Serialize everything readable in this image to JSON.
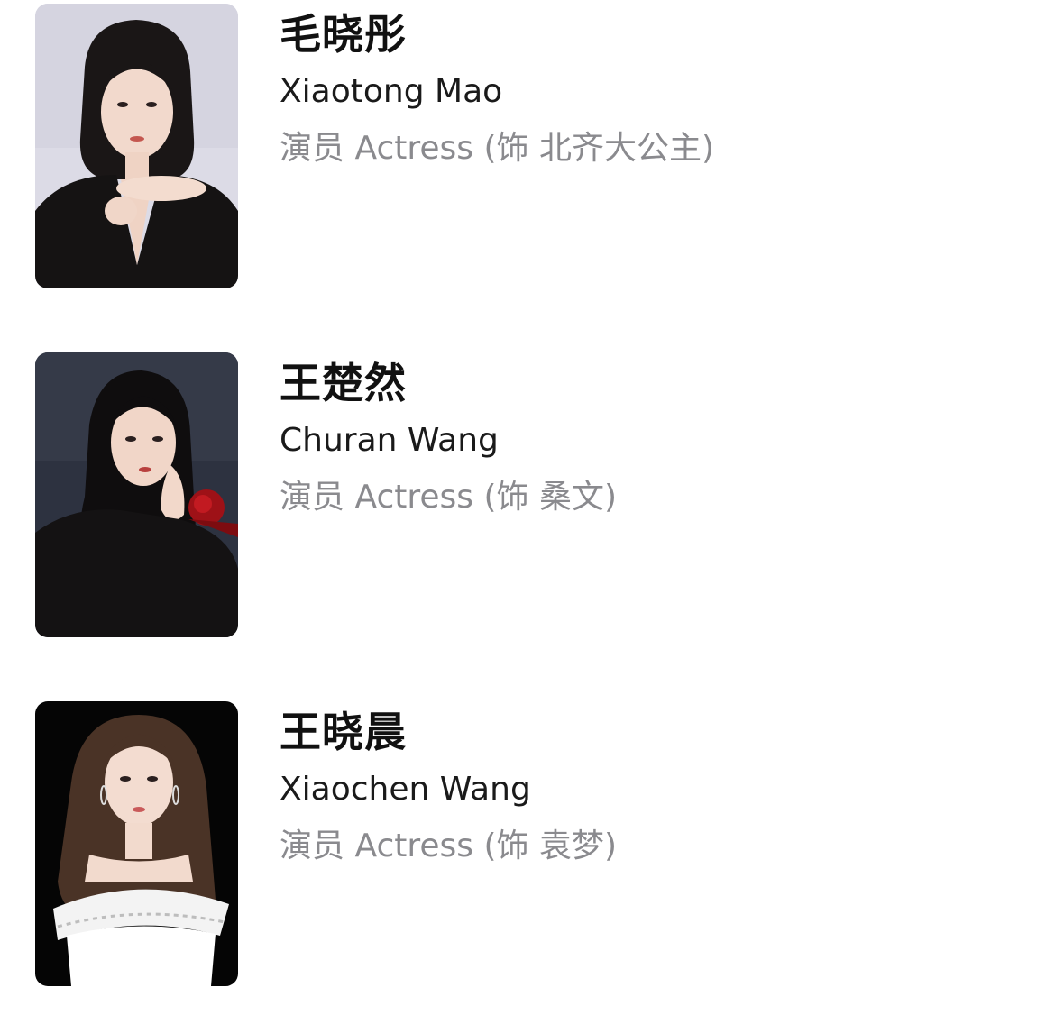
{
  "cast": [
    {
      "name_zh": "毛晓彤",
      "name_en": "Xiaotong Mao",
      "role": "演员 Actress (饰 北齐大公主)",
      "photo_icon": "portrait-photo-icon"
    },
    {
      "name_zh": "王楚然",
      "name_en": "Churan Wang",
      "role": "演员 Actress (饰 桑文)",
      "photo_icon": "portrait-photo-icon"
    },
    {
      "name_zh": "王晓晨",
      "name_en": "Xiaochen Wang",
      "role": "演员 Actress (饰 袁梦)",
      "photo_icon": "portrait-photo-icon"
    }
  ],
  "colors": {
    "name": "#111111",
    "role": "#8a8a8e",
    "background": "#ffffff"
  }
}
